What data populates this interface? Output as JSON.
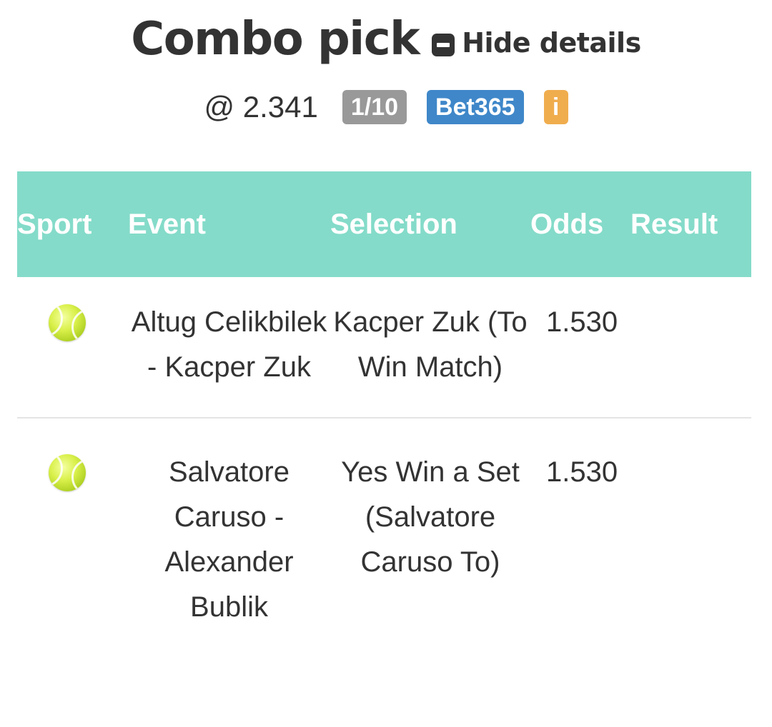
{
  "header": {
    "title": "Combo pick",
    "toggle_label": "Hide details",
    "toggle_icon": "minus-square-icon"
  },
  "summary": {
    "total_odds": "@ 2.341",
    "stake_badge": "1/10",
    "bookmaker_badge": "Bet365",
    "info_badge": "i"
  },
  "colors": {
    "header_bg": "#84dbc9",
    "stake_badge_bg": "#999999",
    "bookmaker_badge_bg": "#3f87c9",
    "info_badge_bg": "#f0ad4e",
    "text": "#333333"
  },
  "table": {
    "columns": {
      "sport": "Sport",
      "event": "Event",
      "selection": "Selection",
      "odds": "Odds",
      "result": "Result"
    },
    "rows": [
      {
        "sport_icon": "tennis-ball-icon",
        "event": "Altug Celikbilek - Kacper Zuk",
        "selection": "Kacper Zuk (To Win Match)",
        "odds": "1.530",
        "result": ""
      },
      {
        "sport_icon": "tennis-ball-icon",
        "event": "Salvatore Caruso - Alexander Bublik",
        "selection": "Yes Win a Set (Salvatore Caruso To)",
        "odds": "1.530",
        "result": ""
      }
    ]
  }
}
